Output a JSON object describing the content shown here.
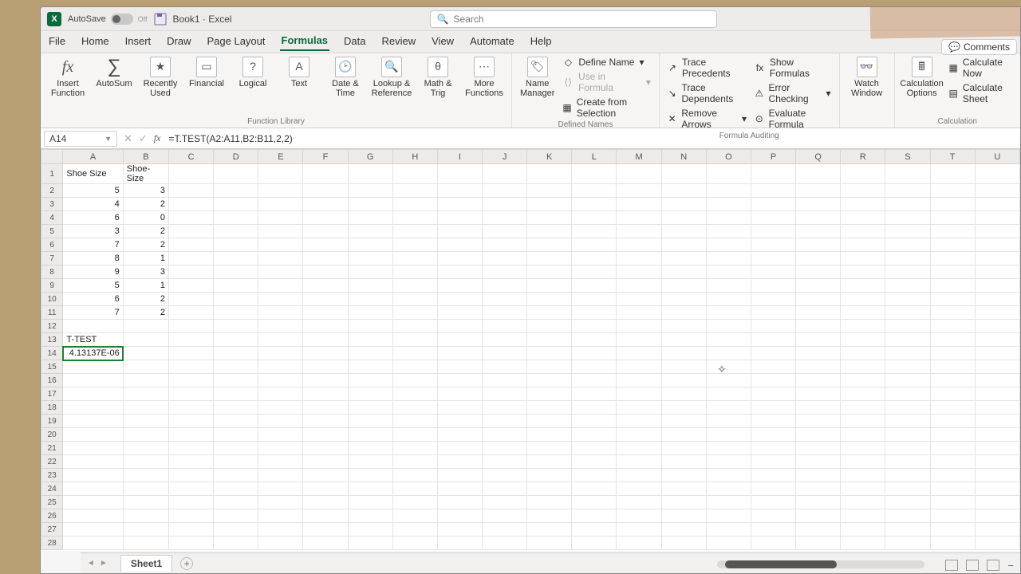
{
  "titlebar": {
    "autosave": "AutoSave",
    "autosave_state": "Off",
    "doc": "Book1",
    "app": "Excel",
    "search_placeholder": "Search"
  },
  "comments_btn": "Comments",
  "tabs": [
    "File",
    "Home",
    "Insert",
    "Draw",
    "Page Layout",
    "Formulas",
    "Data",
    "Review",
    "View",
    "Automate",
    "Help"
  ],
  "active_tab": "Formulas",
  "ribbon": {
    "insert_fn": "Insert Function",
    "autosum": "AutoSum",
    "recent": "Recently Used",
    "financial": "Financial",
    "logical": "Logical",
    "text": "Text",
    "datetime": "Date & Time",
    "lookup": "Lookup & Reference",
    "math": "Math & Trig",
    "more": "More Functions",
    "fnlib_label": "Function Library",
    "name_mgr": "Name Manager",
    "define_name": "Define Name",
    "use_in_formula": "Use in Formula",
    "create_sel": "Create from Selection",
    "defined_label": "Defined Names",
    "trace_prec": "Trace Precedents",
    "trace_dep": "Trace Dependents",
    "remove_arrows": "Remove Arrows",
    "show_formulas": "Show Formulas",
    "error_check": "Error Checking",
    "eval_formula": "Evaluate Formula",
    "auditing_label": "Formula Auditing",
    "watch": "Watch Window",
    "calc_opts": "Calculation Options",
    "calc_now": "Calculate Now",
    "calc_sheet": "Calculate Sheet",
    "calc_label": "Calculation"
  },
  "fbar": {
    "cell_ref": "A14",
    "formula": "=T.TEST(A2:A11,B2:B11,2,2)"
  },
  "columns": [
    "A",
    "B",
    "C",
    "D",
    "E",
    "F",
    "G",
    "H",
    "I",
    "J",
    "K",
    "L",
    "M",
    "N",
    "O",
    "P",
    "Q",
    "R",
    "S",
    "T",
    "U"
  ],
  "rows": 28,
  "cells": {
    "A1": "Shoe Size",
    "B1": "Shoe-Size",
    "A2": "5",
    "B2": "3",
    "A3": "4",
    "B3": "2",
    "A4": "6",
    "B4": "0",
    "A5": "3",
    "B5": "2",
    "A6": "7",
    "B6": "2",
    "A7": "8",
    "B7": "1",
    "A8": "9",
    "B8": "3",
    "A9": "5",
    "B9": "1",
    "A10": "6",
    "B10": "2",
    "A11": "7",
    "B11": "2",
    "A13": "T-TEST",
    "A14": "4.13137E-06"
  },
  "selected_cell": "A14",
  "sheet_tab": "Sheet1",
  "chart_data": {
    "type": "table",
    "title": "Paired shoe-size samples with T.TEST result",
    "columns": [
      "Shoe Size",
      "Shoe-Size"
    ],
    "rows": [
      [
        5,
        3
      ],
      [
        4,
        2
      ],
      [
        6,
        0
      ],
      [
        3,
        2
      ],
      [
        7,
        2
      ],
      [
        8,
        1
      ],
      [
        9,
        3
      ],
      [
        5,
        1
      ],
      [
        6,
        2
      ],
      [
        7,
        2
      ]
    ],
    "t_test": {
      "formula": "=T.TEST(A2:A11,B2:B11,2,2)",
      "p_value": 4.13137e-06
    }
  }
}
